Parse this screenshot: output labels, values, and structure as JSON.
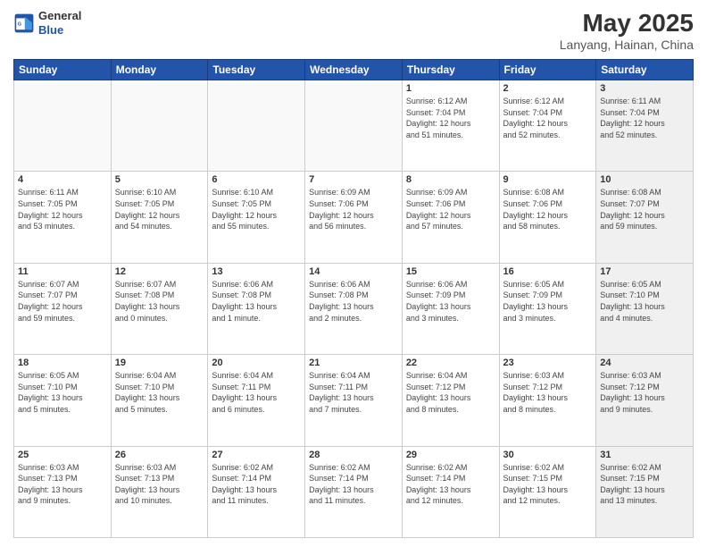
{
  "header": {
    "logo": {
      "line1": "General",
      "line2": "Blue"
    },
    "title": "May 2025",
    "location": "Lanyang, Hainan, China"
  },
  "weekdays": [
    "Sunday",
    "Monday",
    "Tuesday",
    "Wednesday",
    "Thursday",
    "Friday",
    "Saturday"
  ],
  "weeks": [
    [
      {
        "day": "",
        "info": "",
        "empty": true
      },
      {
        "day": "",
        "info": "",
        "empty": true
      },
      {
        "day": "",
        "info": "",
        "empty": true
      },
      {
        "day": "",
        "info": "",
        "empty": true
      },
      {
        "day": "1",
        "info": "Sunrise: 6:12 AM\nSunset: 7:04 PM\nDaylight: 12 hours\nand 51 minutes."
      },
      {
        "day": "2",
        "info": "Sunrise: 6:12 AM\nSunset: 7:04 PM\nDaylight: 12 hours\nand 52 minutes."
      },
      {
        "day": "3",
        "info": "Sunrise: 6:11 AM\nSunset: 7:04 PM\nDaylight: 12 hours\nand 52 minutes.",
        "shaded": true
      }
    ],
    [
      {
        "day": "4",
        "info": "Sunrise: 6:11 AM\nSunset: 7:05 PM\nDaylight: 12 hours\nand 53 minutes."
      },
      {
        "day": "5",
        "info": "Sunrise: 6:10 AM\nSunset: 7:05 PM\nDaylight: 12 hours\nand 54 minutes."
      },
      {
        "day": "6",
        "info": "Sunrise: 6:10 AM\nSunset: 7:05 PM\nDaylight: 12 hours\nand 55 minutes."
      },
      {
        "day": "7",
        "info": "Sunrise: 6:09 AM\nSunset: 7:06 PM\nDaylight: 12 hours\nand 56 minutes."
      },
      {
        "day": "8",
        "info": "Sunrise: 6:09 AM\nSunset: 7:06 PM\nDaylight: 12 hours\nand 57 minutes."
      },
      {
        "day": "9",
        "info": "Sunrise: 6:08 AM\nSunset: 7:06 PM\nDaylight: 12 hours\nand 58 minutes."
      },
      {
        "day": "10",
        "info": "Sunrise: 6:08 AM\nSunset: 7:07 PM\nDaylight: 12 hours\nand 59 minutes.",
        "shaded": true
      }
    ],
    [
      {
        "day": "11",
        "info": "Sunrise: 6:07 AM\nSunset: 7:07 PM\nDaylight: 12 hours\nand 59 minutes."
      },
      {
        "day": "12",
        "info": "Sunrise: 6:07 AM\nSunset: 7:08 PM\nDaylight: 13 hours\nand 0 minutes."
      },
      {
        "day": "13",
        "info": "Sunrise: 6:06 AM\nSunset: 7:08 PM\nDaylight: 13 hours\nand 1 minute."
      },
      {
        "day": "14",
        "info": "Sunrise: 6:06 AM\nSunset: 7:08 PM\nDaylight: 13 hours\nand 2 minutes."
      },
      {
        "day": "15",
        "info": "Sunrise: 6:06 AM\nSunset: 7:09 PM\nDaylight: 13 hours\nand 3 minutes."
      },
      {
        "day": "16",
        "info": "Sunrise: 6:05 AM\nSunset: 7:09 PM\nDaylight: 13 hours\nand 3 minutes."
      },
      {
        "day": "17",
        "info": "Sunrise: 6:05 AM\nSunset: 7:10 PM\nDaylight: 13 hours\nand 4 minutes.",
        "shaded": true
      }
    ],
    [
      {
        "day": "18",
        "info": "Sunrise: 6:05 AM\nSunset: 7:10 PM\nDaylight: 13 hours\nand 5 minutes."
      },
      {
        "day": "19",
        "info": "Sunrise: 6:04 AM\nSunset: 7:10 PM\nDaylight: 13 hours\nand 5 minutes."
      },
      {
        "day": "20",
        "info": "Sunrise: 6:04 AM\nSunset: 7:11 PM\nDaylight: 13 hours\nand 6 minutes."
      },
      {
        "day": "21",
        "info": "Sunrise: 6:04 AM\nSunset: 7:11 PM\nDaylight: 13 hours\nand 7 minutes."
      },
      {
        "day": "22",
        "info": "Sunrise: 6:04 AM\nSunset: 7:12 PM\nDaylight: 13 hours\nand 8 minutes."
      },
      {
        "day": "23",
        "info": "Sunrise: 6:03 AM\nSunset: 7:12 PM\nDaylight: 13 hours\nand 8 minutes."
      },
      {
        "day": "24",
        "info": "Sunrise: 6:03 AM\nSunset: 7:12 PM\nDaylight: 13 hours\nand 9 minutes.",
        "shaded": true
      }
    ],
    [
      {
        "day": "25",
        "info": "Sunrise: 6:03 AM\nSunset: 7:13 PM\nDaylight: 13 hours\nand 9 minutes."
      },
      {
        "day": "26",
        "info": "Sunrise: 6:03 AM\nSunset: 7:13 PM\nDaylight: 13 hours\nand 10 minutes."
      },
      {
        "day": "27",
        "info": "Sunrise: 6:02 AM\nSunset: 7:14 PM\nDaylight: 13 hours\nand 11 minutes."
      },
      {
        "day": "28",
        "info": "Sunrise: 6:02 AM\nSunset: 7:14 PM\nDaylight: 13 hours\nand 11 minutes."
      },
      {
        "day": "29",
        "info": "Sunrise: 6:02 AM\nSunset: 7:14 PM\nDaylight: 13 hours\nand 12 minutes."
      },
      {
        "day": "30",
        "info": "Sunrise: 6:02 AM\nSunset: 7:15 PM\nDaylight: 13 hours\nand 12 minutes."
      },
      {
        "day": "31",
        "info": "Sunrise: 6:02 AM\nSunset: 7:15 PM\nDaylight: 13 hours\nand 13 minutes.",
        "shaded": true
      }
    ]
  ]
}
